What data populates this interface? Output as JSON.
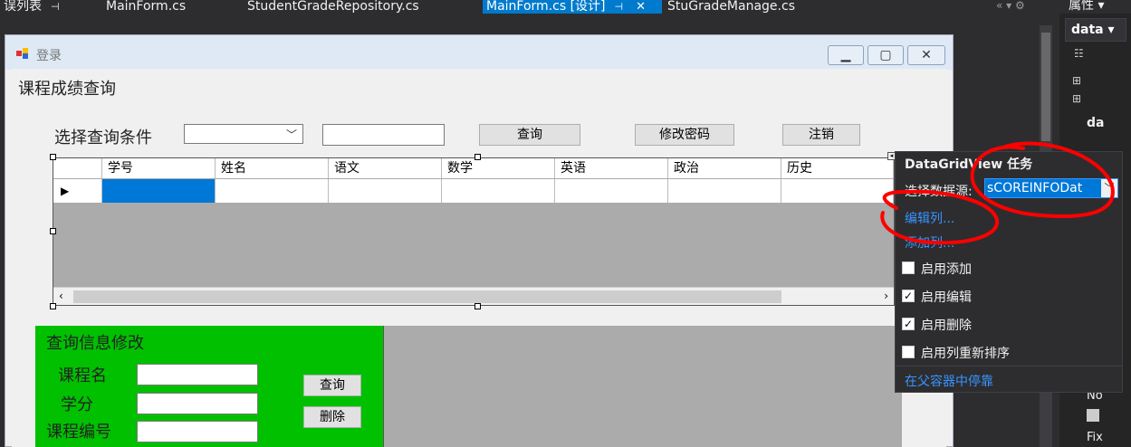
{
  "tabs": [
    {
      "label": "误列表",
      "pin": "⊣"
    },
    {
      "label": "MainForm.cs"
    },
    {
      "label": "StudentGradeRepository.cs"
    },
    {
      "label": "MainForm.cs [设计]",
      "pin": "⊣",
      "close": "✕",
      "active": true
    },
    {
      "label": "StuGradeManage.cs"
    }
  ],
  "tab_overflow": "«  ▾  ⚙",
  "properties": {
    "title": "属性 ▾",
    "combo": "data ▾",
    "label_da": "da",
    "label_no": "No",
    "label_fix": "Fix"
  },
  "window": {
    "title": "登录",
    "heading": "课程成绩查询",
    "filter_label": "选择查询条件",
    "query_button": "查询",
    "change_password_button": "修改密码",
    "logout_button": "注销",
    "grid": {
      "columns": [
        "学号",
        "姓名",
        "语文",
        "数学",
        "英语",
        "政治",
        "历史"
      ],
      "row_indicator": "▶"
    },
    "edit_panel": {
      "title": "查询信息修改",
      "course_name_label": "课程名",
      "credit_label": "学分",
      "course_id_label": "课程编号",
      "query_button": "查询",
      "delete_button": "删除"
    }
  },
  "smart_tag": {
    "title": "DataGridView 任务",
    "datasource_label": "选择数据源:",
    "datasource_value": "sCOREINFODat",
    "edit_columns": "编辑列...",
    "add_column": "添加列...",
    "options": [
      {
        "label": "启用添加",
        "checked": false
      },
      {
        "label": "启用编辑",
        "checked": true
      },
      {
        "label": "启用删除",
        "checked": true
      },
      {
        "label": "启用列重新排序",
        "checked": false
      }
    ],
    "dock": "在父容器中停靠"
  },
  "colors": {
    "accent": "#007acc",
    "green_panel": "#00c000",
    "annotation": "#ff0000",
    "selected_cell": "#0078d7"
  }
}
